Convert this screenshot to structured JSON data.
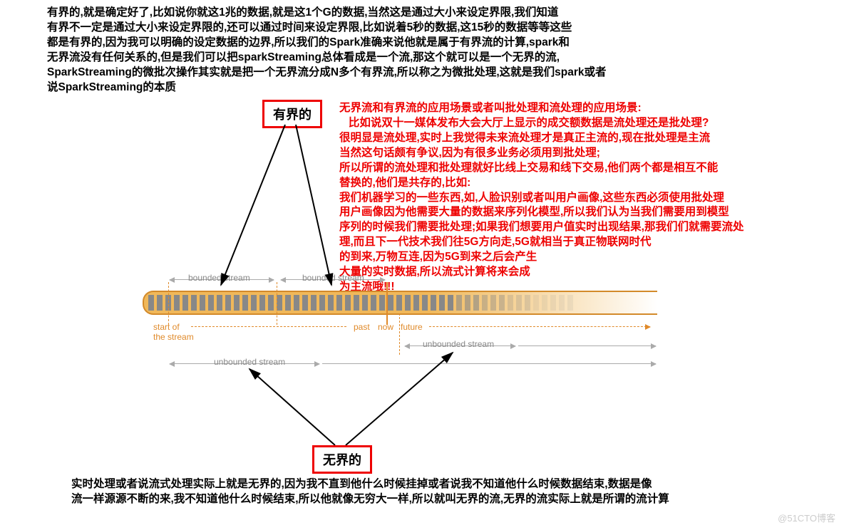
{
  "top_text": "有界的,就是确定好了,比如说你就这1兆的数据,就是这1个G的数据,当然这是通过大小来设定界限,我们知道\n有界不一定是通过大小来设定界限的,还可以通过时间来设定界限,比如说着5秒的数据,这15秒的数据等等这些\n都是有界的,因为我可以明确的设定数据的边界,所以我们的Spark准确来说他就是属于有界流的计算,spark和\n无界流没有任何关系的,但是我们可以把sparkStreaming总体看成是一个流,那这个就可以是一个无界的流,\nSparkStreaming的微批次操作其实就是把一个无界流分成N多个有界流,所以称之为微批处理,这就是我们spark或者\n说SparkStreaming的本质",
  "box_top": "有界的",
  "box_bottom": "无界的",
  "red_text": "无界流和有界流的应用场景或者叫批处理和流处理的应用场景:\n   比如说双十一媒体发布大会大厅上显示的成交额数据是流处理还是批处理?\n很明显是流处理,实时上我觉得未来流处理才是真正主流的,现在批处理是主流\n当然这句话颇有争议,因为有很多业务必须用到批处理;\n所以所谓的流处理和批处理就好比线上交易和线下交易,他们两个都是相互不能\n替换的,他们是共存的,比如:\n我们机器学习的一些东西,如,人脸识别或者叫用户画像,这些东西必须使用批处理\n用户画像因为他需要大量的数据来序列化模型,所以我们认为当我们需要用到模型\n序列的时候我们需要批处理;如果我们想要用户值实时出现结果,那我们们就需要流处\n理,而且下一代技术我们往5G方向走,5G就相当于真正物联网时代\n的到来,万物互连,因为5G到来之后会产生\n大量的实时数据,所以流式计算将来会成\n为主流哦!!!",
  "bottom_text": "实时处理或者说流式处理实际上就是无界的,因为我不直到他什么时候挂掉或者说我不知道他什么时候数据结束,数据是像\n流一样源源不断的来,我不知道他什么时候结束,所以他就像无穷大一样,所以就叫无界的流,无界的流实际上就是所谓的流计算",
  "labels": {
    "bounded1": "bounded stream",
    "bounded2": "bounded stream",
    "start": "start of\nthe stream",
    "past": "past",
    "now": "now",
    "future": "future",
    "unbounded1": "unbounded stream",
    "unbounded2": "unbounded stream"
  },
  "watermark": "@51CTO博客"
}
